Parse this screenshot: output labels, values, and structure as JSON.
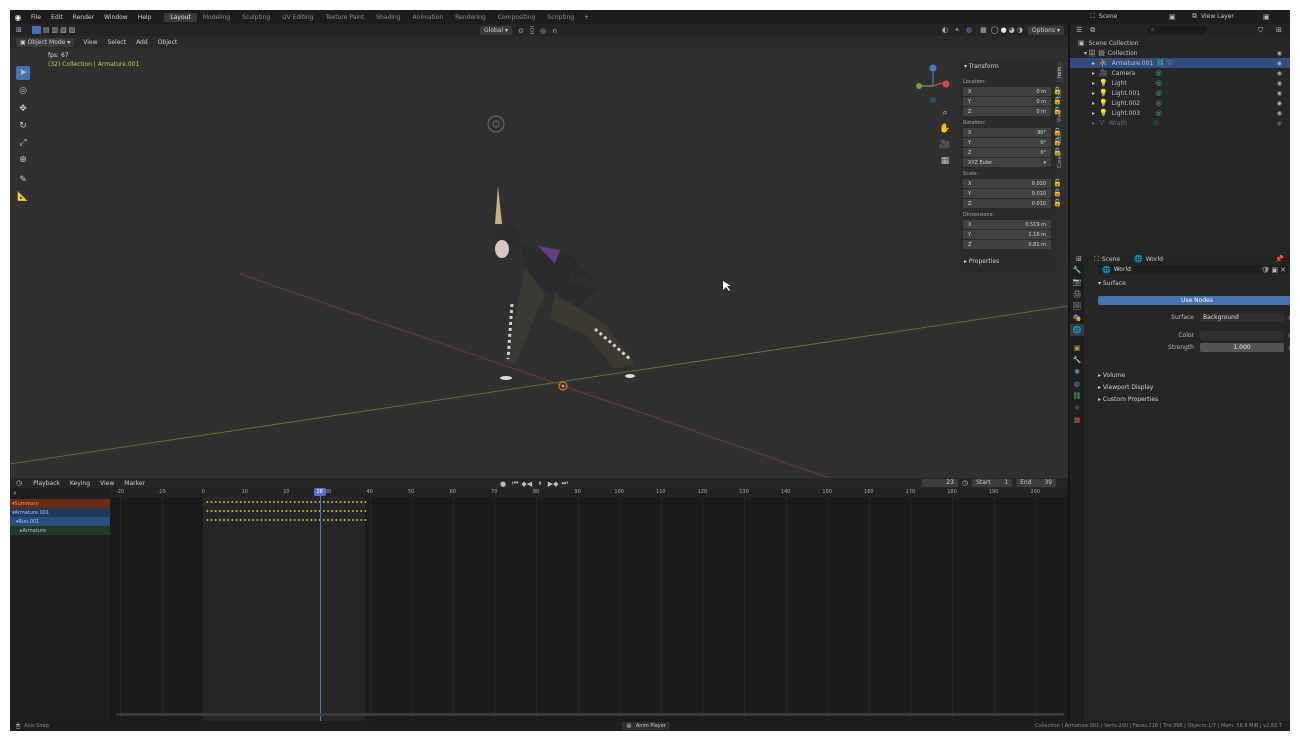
{
  "menubar": {
    "items": [
      "File",
      "Edit",
      "Render",
      "Window",
      "Help"
    ]
  },
  "workspaces": [
    "Layout",
    "Modeling",
    "Sculpting",
    "UV Editing",
    "Texture Paint",
    "Shading",
    "Animation",
    "Rendering",
    "Compositing",
    "Scripting"
  ],
  "active_workspace": "Layout",
  "add_workspace": "+",
  "scene": {
    "name": "Scene",
    "view_layer": "View Layer"
  },
  "viewport": {
    "mode": "Object Mode",
    "menus": [
      "View",
      "Select",
      "Add",
      "Object"
    ],
    "orientation": "Global",
    "options": "Options",
    "fps": "fps: 67",
    "object_info": "(32) Collection | Armature.001"
  },
  "sidetabs": [
    "Item",
    "Tool",
    "View",
    "Edit",
    "Create"
  ],
  "npanel": {
    "title": "Transform",
    "location_label": "Location:",
    "rotation_label": "Rotation:",
    "scale_label": "Scale:",
    "dimensions_label": "Dimensions:",
    "mode": "XYZ Euler",
    "properties": "Properties",
    "location": [
      [
        "X",
        "0 m"
      ],
      [
        "Y",
        "0 m"
      ],
      [
        "Z",
        "0 m"
      ]
    ],
    "rotation": [
      [
        "X",
        "90°"
      ],
      [
        "Y",
        "0°"
      ],
      [
        "Z",
        "0°"
      ]
    ],
    "scale": [
      [
        "X",
        "0.010"
      ],
      [
        "Y",
        "0.010"
      ],
      [
        "Z",
        "0.010"
      ]
    ],
    "dimensions": [
      [
        "X",
        "0.519 m"
      ],
      [
        "Y",
        "1.16 m"
      ],
      [
        "Z",
        "0.81 m"
      ]
    ]
  },
  "outliner": {
    "root": "Scene Collection",
    "collection": "Collection",
    "items": [
      "Armature.001",
      "Camera",
      "Light",
      "Light.001",
      "Light.002",
      "Light.003",
      "Wrath"
    ]
  },
  "properties": {
    "tab_scene": "Scene",
    "tab_world": "World",
    "world_name": "World",
    "surface_section": "Surface",
    "use_nodes": "Use Nodes",
    "surface_label": "Surface",
    "surface_value": "Background",
    "color_label": "Color",
    "strength_label": "Strength",
    "strength_value": "1.000",
    "sections": [
      "Volume",
      "Viewport Display",
      "Custom Properties"
    ]
  },
  "timeline": {
    "menus": [
      "Playback",
      "Keying",
      "View",
      "Marker"
    ],
    "current_frame": "23",
    "start_label": "Start",
    "start": "1",
    "end_label": "End",
    "end": "39",
    "playhead": "28",
    "ticks": [
      "-20",
      "-10",
      "0",
      "10",
      "20",
      "30",
      "40",
      "50",
      "60",
      "70",
      "80",
      "90",
      "100",
      "110",
      "120",
      "130",
      "140",
      "150",
      "160",
      "170",
      "180",
      "190",
      "200"
    ],
    "channels": [
      "Summary",
      "Armature.001",
      "Run.001",
      "Armature"
    ]
  },
  "status": {
    "left": "Axis Snap",
    "center": "Anim Player",
    "right": "Collection | Armature.001 | Verts:200 | Faces:216 | Tris:396 | Objects:1/7 | Mem: 56.8 MiB | v2.82.7"
  },
  "colors": {
    "accent": "#4772b3",
    "summary": "#6b2b17",
    "armature_channel": "#1f3a5a",
    "action_channel": "#29507a",
    "bone_channel": "#233a27",
    "playhead": "#5a6fc4",
    "key": "#e8c34a"
  }
}
